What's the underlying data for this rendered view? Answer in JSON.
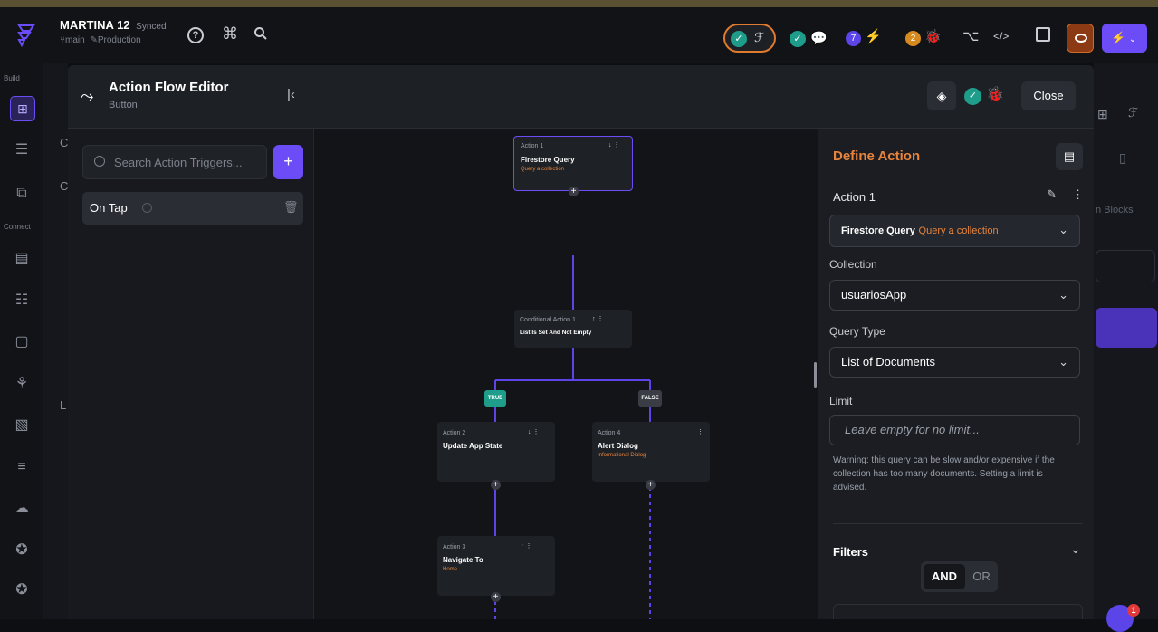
{
  "project": {
    "name": "MARTINA 12",
    "sync": "Synced",
    "branch": "main",
    "env": "Production"
  },
  "topbar": {
    "badge_a": "7",
    "badge_b": "2"
  },
  "rail": {
    "build": "Build",
    "connect": "Connect"
  },
  "editor": {
    "title": "Action Flow Editor",
    "subtitle": "Button",
    "close": "Close"
  },
  "triggers": {
    "search_placeholder": "Search Action Triggers...",
    "items": [
      {
        "label": "On Tap"
      }
    ]
  },
  "flow": {
    "action1": {
      "num": "Action 1",
      "title": "Firestore Query",
      "sub": "Query a collection"
    },
    "cond": {
      "num": "Conditional Action 1",
      "title": "List Is Set And Not Empty"
    },
    "true_label": "TRUE",
    "false_label": "FALSE",
    "action2": {
      "num": "Action 2",
      "title": "Update App State"
    },
    "action4": {
      "num": "Action 4",
      "title": "Alert Dialog",
      "sub": "Informational Dialog"
    },
    "action3": {
      "num": "Action 3",
      "title": "Navigate To",
      "sub": "Home"
    }
  },
  "define": {
    "title": "Define Action",
    "action_name": "Action 1",
    "action_type": "Firestore Query",
    "action_type_sub": "Query a collection",
    "collection_label": "Collection",
    "collection_value": "usuariosApp",
    "query_type_label": "Query Type",
    "query_type_value": "List of Documents",
    "limit_label": "Limit",
    "limit_placeholder": "Leave empty for no limit...",
    "warning": "Warning: this query can be slow and/or expensive if the collection has too many documents. Setting a limit is advised.",
    "filters_label": "Filters",
    "and": "AND",
    "or": "OR"
  },
  "right_bg": {
    "blocks": "n Blocks"
  },
  "bg_left_letters": {
    "a": "C",
    "b": "C",
    "c": "L"
  },
  "notif": "1",
  "colors": {
    "accent": "#6b4cf6",
    "orange": "#e8843c",
    "teal": "#1f9d8b",
    "flow_line": "#5b45e8"
  }
}
